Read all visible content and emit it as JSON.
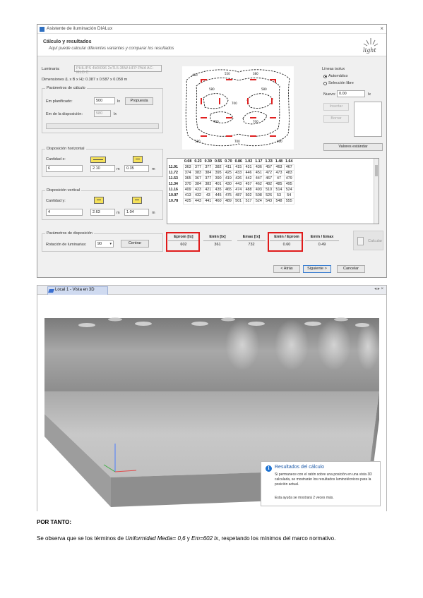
{
  "wizard": {
    "title": "Asistente de iluminación DIALux",
    "close_glyph": "×",
    "header_title": "Cálculo y resultados",
    "header_subtitle": "Aquí puede calcular diferentes variantes y comparar los resultados",
    "logo_text": "light",
    "luminaria_label": "Luminaria:",
    "luminaria_value": "PHILIPS 4MX096 2xTL5-35W-HFP PMA AC-MLO C",
    "dimensions_label": "Dimensiones (L x B x H): 0.387 x 0.587 x 0.058 m",
    "params_group": "Parámetros de cálculo",
    "flux_label": "Em planificado:",
    "flux_value": "500",
    "flux_unit": "lx",
    "propuesta_btn": "Propuesta",
    "em_label": "Em de la disposición:",
    "em_value": "580",
    "em_unit": "lx",
    "horiz_group": "Disposición horizontal",
    "horiz_count_label": "Cantidad x:",
    "horiz_count": "6",
    "horiz_dist": "2.10",
    "horiz_dist_unit": "m",
    "horiz_offset": "0.35",
    "horiz_offset_unit": "m",
    "vert_group": "Disposición vertical",
    "vert_count_label": "Cantidad y:",
    "vert_count": "4",
    "vert_dist": "2.63",
    "vert_dist_unit": "m",
    "vert_offset": "1.04",
    "vert_offset_unit": "m",
    "disp_group": "Parámetros de disposición",
    "rotation_label": "Rotación de luminarias:",
    "rotation_value": "90",
    "center_btn": "Centrar",
    "isolines_title": "Líneas isolux",
    "radio_auto": "Automático",
    "radio_select": "Selección libre",
    "nuevo_label": "Nuevo:",
    "nuevo_value": "0.00",
    "nuevo_unit": "lx",
    "insert_btn": "Insertar",
    "delete_btn": "Borrar",
    "defaults_btn": "Valores estándar",
    "calc_btn": "Calcular",
    "back_btn": "< Atrás",
    "next_btn": "Siguiente >",
    "cancel_btn": "Cancelar",
    "isolux_labels": [
      "460",
      "550",
      "380",
      "580",
      "700",
      "700",
      "700",
      "580",
      "580",
      "700",
      "460"
    ]
  },
  "table": {
    "columns": [
      "0.08",
      "0.23",
      "0.39",
      "0.55",
      "0.70",
      "0.86",
      "1.02",
      "1.17",
      "1.33",
      "1.48",
      "1.64"
    ],
    "rows": [
      {
        "y": "11.91",
        "vals": [
          "363",
          "377",
          "377",
          "382",
          "411",
          "415",
          "431",
          "436",
          "457",
          "463",
          "467"
        ]
      },
      {
        "y": "11.72",
        "vals": [
          "374",
          "383",
          "384",
          "395",
          "425",
          "433",
          "446",
          "451",
          "472",
          "473",
          "483"
        ]
      },
      {
        "y": "11.53",
        "vals": [
          "365",
          "367",
          "377",
          "390",
          "419",
          "426",
          "442",
          "447",
          "467",
          "47",
          "479"
        ]
      },
      {
        "y": "11.34",
        "vals": [
          "370",
          "384",
          "383",
          "401",
          "430",
          "443",
          "457",
          "462",
          "482",
          "485",
          "495"
        ]
      },
      {
        "y": "11.16",
        "vals": [
          "409",
          "423",
          "421",
          "435",
          "465",
          "474",
          "488",
          "493",
          "510",
          "514",
          "524"
        ]
      },
      {
        "y": "10.97",
        "vals": [
          "413",
          "432",
          "43",
          "445",
          "475",
          "487",
          "502",
          "508",
          "526",
          "53",
          "54"
        ]
      },
      {
        "y": "10.78",
        "vals": [
          "425",
          "443",
          "441",
          "460",
          "489",
          "501",
          "517",
          "524",
          "543",
          "548",
          "555"
        ]
      }
    ]
  },
  "stats": {
    "headers": [
      "Eprom [lx]",
      "Emin [lx]",
      "Emax [lx]",
      "Emin / Eprom",
      "Emin / Emax"
    ],
    "values": [
      "602",
      "361",
      "732",
      "0.60",
      "0.49"
    ]
  },
  "view3d": {
    "tab_label": "Local 1 - Vista en 3D",
    "tab_controls": "◂ ▸ ×",
    "tooltip_title": "Resultados del cálculo",
    "tooltip_body": "Si permanece con el ratón sobre una posición en una vista 3D calculada, se mostrarán los resultados luminotécnicos para la posición actual.",
    "tooltip_note": "Esta ayuda se mostrará 2 veces más.",
    "info_glyph": "i"
  },
  "document": {
    "heading": "POR TANTO:",
    "para_1": "Se observa que se los términos de ",
    "para_em1": "Uniformidad Media= 0,6",
    "para_2": " y ",
    "para_em2": "Em=602 lx",
    "para_3": ", respetando los mínimos del marco normativo."
  },
  "colors": {
    "highlight_red": "#e01b1b",
    "accent_blue": "#1e73d2",
    "room_floor": "#b7b7b7",
    "room_wall": "#8d8d8d"
  }
}
